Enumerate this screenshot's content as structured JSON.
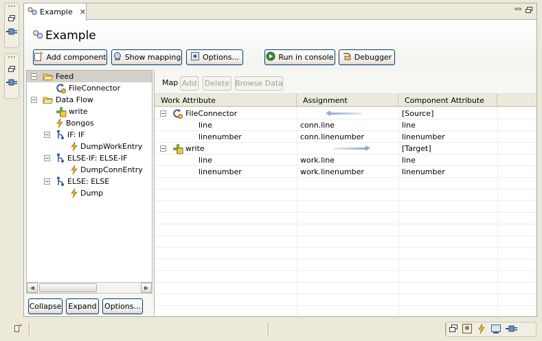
{
  "editor_tab": {
    "title": "Example",
    "close_glyph": "✕"
  },
  "form": {
    "title": "Example"
  },
  "toolbar": {
    "add_component": "Add component",
    "show_mapping": "Show mapping",
    "options": "Options...",
    "run_in_console": "Run in console",
    "debugger": "Debugger"
  },
  "tree": {
    "items": [
      {
        "label": "Feed",
        "toggle": "−",
        "icon": "folder-open-icon"
      },
      {
        "label": "FileConnector",
        "icon": "connector-icon"
      },
      {
        "label": "Data Flow",
        "toggle": "−",
        "icon": "folder-open-icon"
      },
      {
        "label": "write",
        "icon": "write-icon"
      },
      {
        "label": "Bongos",
        "icon": "lightning-icon"
      },
      {
        "label": "IF: IF",
        "toggle": "−",
        "icon": "branch-icon"
      },
      {
        "label": "DumpWorkEntry",
        "icon": "lightning-icon"
      },
      {
        "label": "ELSE-IF: ELSE-IF",
        "toggle": "−",
        "icon": "branch-icon"
      },
      {
        "label": "DumpConnEntry",
        "icon": "lightning-icon"
      },
      {
        "label": "ELSE: ELSE",
        "toggle": "−",
        "icon": "branch-icon"
      },
      {
        "label": "Dump",
        "icon": "lightning-icon"
      }
    ],
    "collapse": "Collapse",
    "expand": "Expand",
    "options": "Options..."
  },
  "mapping": {
    "toolbar_label": "Map",
    "add": "Add",
    "delete": "Delete",
    "browse_data": "Browse Data",
    "columns": [
      "Work Attribute",
      "Assignment",
      "Component Attribute"
    ],
    "rows": [
      {
        "work": "FileConnector",
        "assignment": "",
        "component": "[Source]",
        "toggle": "−",
        "icon": "connector-icon",
        "arrow": "left"
      },
      {
        "work": "line",
        "assignment": "conn.line",
        "component": "line"
      },
      {
        "work": "linenumber",
        "assignment": "conn.linenumber",
        "component": "linenumber"
      },
      {
        "work": "write",
        "assignment": "",
        "component": "[Target]",
        "toggle": "−",
        "icon": "write-icon",
        "arrow": "right"
      },
      {
        "work": "line",
        "assignment": "work.line",
        "component": "line"
      },
      {
        "work": "linenumber",
        "assignment": "work.linenumber",
        "component": "linenumber"
      }
    ]
  },
  "colors": {
    "accent": "#003c74",
    "selection": "#d4d0c8",
    "arrow": "#8fa7c9"
  }
}
